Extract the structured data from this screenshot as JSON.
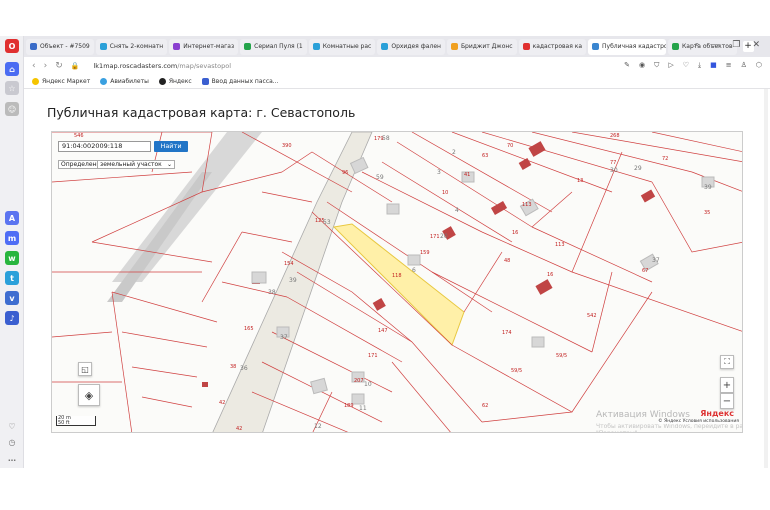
{
  "browser": {
    "tabs": [
      {
        "label": "Объект - #7509",
        "color": "#3a6cc8"
      },
      {
        "label": "Снять 2-комнатн",
        "color": "#2aa0d8"
      },
      {
        "label": "Интернет-магаз",
        "color": "#8a3fd0"
      },
      {
        "label": "Сериал Пуля (1",
        "color": "#24a34a"
      },
      {
        "label": "Комнатные рас",
        "color": "#2aa0d8"
      },
      {
        "label": "Орхидея фален",
        "color": "#2aa0d8"
      },
      {
        "label": "Бриджит Джонс",
        "color": "#f0a020"
      },
      {
        "label": "кадастровая ка",
        "color": "#e03030"
      },
      {
        "label": "Публичная кадастровая",
        "color": "#3a86d0",
        "active": true
      },
      {
        "label": "Карта объектов",
        "color": "#24a34a"
      }
    ],
    "new_tab": "+",
    "url_host": "lk1map.roscadasters.com",
    "url_path": "/map/sevastopol",
    "bookmarks": [
      "Яндекс Маркет",
      "Авиабилеты",
      "Яндекс",
      "Ввод данных пасса..."
    ]
  },
  "page": {
    "title": "Публичная кадастровая карта: г. Севастополь"
  },
  "map": {
    "search_value": "91:04:002009:118",
    "find_label": "Найти",
    "define_label": "Определение",
    "define_value": "земельный участок",
    "scale_m": "20 m",
    "scale_ft": "50 ft",
    "yandex": "Яндекс",
    "copyright": "© Яндекс  Условия использования",
    "activation_title": "Активация Windows",
    "activation_text": "Чтобы активировать Windows, перейдите в раздел \"Параметры\".",
    "zoom_in": "+",
    "zoom_out": "−",
    "labels": [
      "546",
      "390",
      "179",
      "58",
      "2",
      "63",
      "70",
      "268",
      "72",
      "96",
      "59",
      "3",
      "41",
      "10",
      "13",
      "77",
      "30",
      "29",
      "4",
      "113",
      "125",
      "53",
      "171",
      "20",
      "16",
      "39",
      "35",
      "159",
      "48",
      "113",
      "67",
      "37",
      "154",
      "39",
      "16",
      "38",
      "118",
      "6",
      "542",
      "165",
      "147",
      "37",
      "174",
      "59/5",
      "38",
      "36",
      "171",
      "59/5",
      "207",
      "10",
      "189",
      "11",
      "42",
      "12",
      "62",
      "42"
    ],
    "selected_parcel": "91:04:002009:118"
  }
}
